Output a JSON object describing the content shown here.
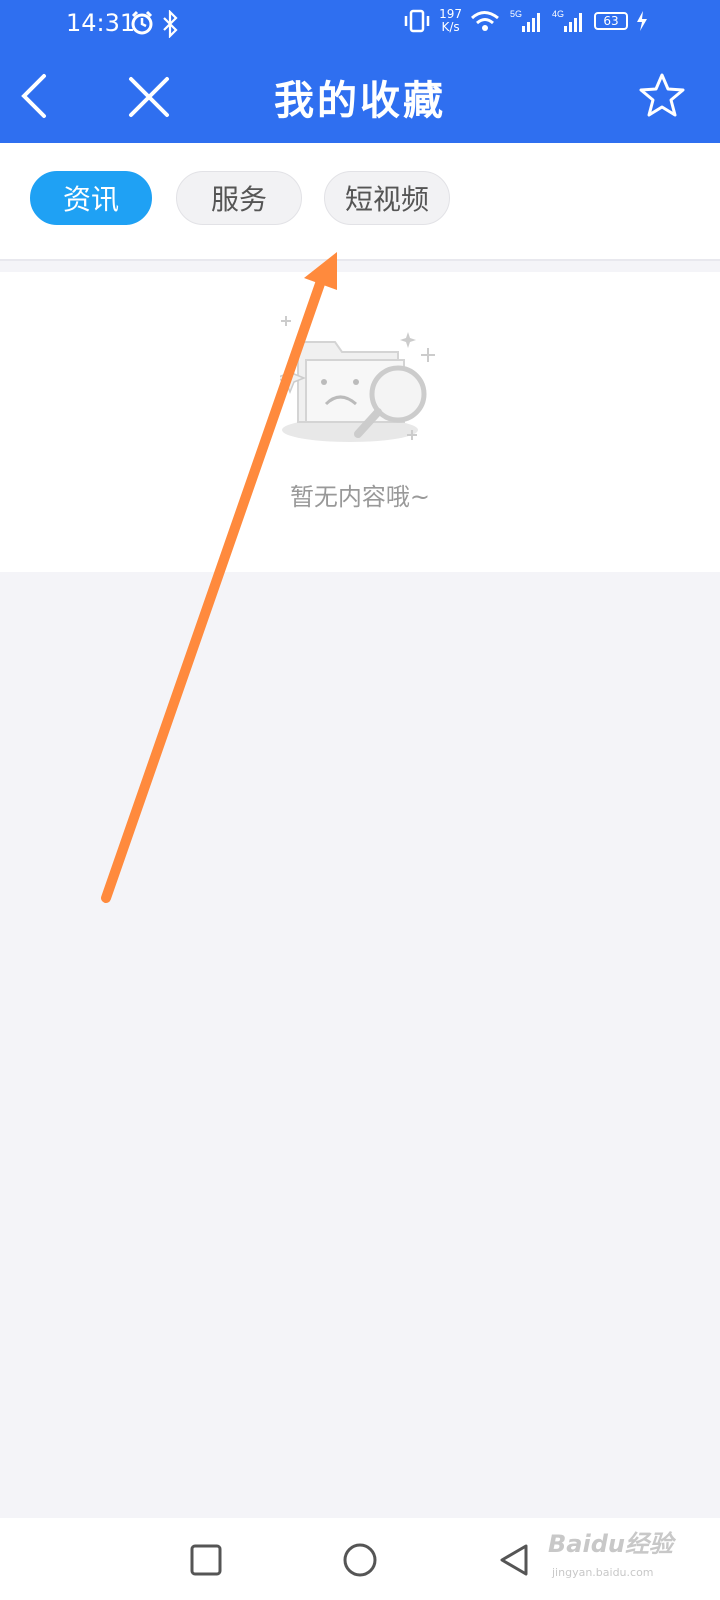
{
  "status_bar": {
    "time": "14:31",
    "net_speed_value": "197",
    "net_speed_unit": "K/s",
    "battery": "63",
    "icons": [
      "alarm-icon",
      "bluetooth-icon",
      "vibrate-icon",
      "wifi-icon",
      "signal-5g-icon",
      "signal-4g-icon",
      "battery-icon",
      "charging-icon"
    ]
  },
  "header": {
    "title": "我的收藏",
    "back_icon": "chevron-left-icon",
    "close_icon": "close-icon",
    "favorite_icon": "star-outline-icon",
    "color": "#2f6ff0"
  },
  "tabs": [
    {
      "label": "资讯",
      "active": true
    },
    {
      "label": "服务",
      "active": false
    },
    {
      "label": "短视频",
      "active": false
    }
  ],
  "empty_state": {
    "message": "暂无内容哦~",
    "icon": "empty-folder-search-icon"
  },
  "annotation": {
    "color": "#ff8a3d"
  },
  "system_nav": {
    "buttons": [
      "recent-apps-icon",
      "home-icon",
      "back-triangle-icon"
    ]
  },
  "watermark": {
    "text": "Baidu经验",
    "sub": "jingyan.baidu.com"
  }
}
